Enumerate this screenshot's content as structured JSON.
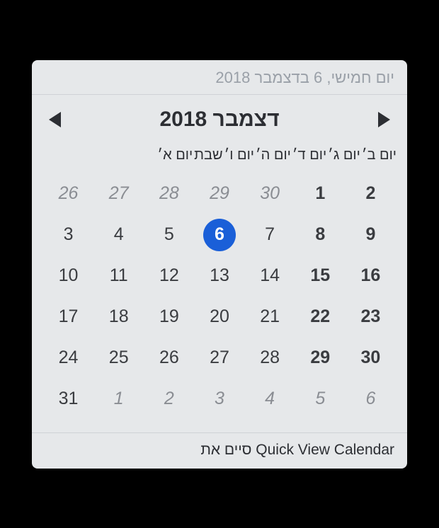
{
  "header_date": "יום חמישי, 6 בדצמבר 2018",
  "month_title": "דצמבר 2018",
  "weekdays": [
    "יום א׳",
    "שבת",
    "יום ו׳",
    "יום ה׳",
    "יום ד׳",
    "יום ג׳",
    "יום ב׳"
  ],
  "footer": "סיים את Quick View Calendar",
  "days": [
    {
      "n": "26",
      "other": true
    },
    {
      "n": "27",
      "other": true
    },
    {
      "n": "28",
      "other": true
    },
    {
      "n": "29",
      "other": true
    },
    {
      "n": "30",
      "other": true
    },
    {
      "n": "1",
      "bold": true
    },
    {
      "n": "2",
      "bold": true
    },
    {
      "n": "3"
    },
    {
      "n": "4"
    },
    {
      "n": "5"
    },
    {
      "n": "6",
      "selected": true
    },
    {
      "n": "7"
    },
    {
      "n": "8",
      "bold": true
    },
    {
      "n": "9",
      "bold": true
    },
    {
      "n": "10"
    },
    {
      "n": "11"
    },
    {
      "n": "12"
    },
    {
      "n": "13"
    },
    {
      "n": "14"
    },
    {
      "n": "15",
      "bold": true
    },
    {
      "n": "16",
      "bold": true
    },
    {
      "n": "17"
    },
    {
      "n": "18"
    },
    {
      "n": "19"
    },
    {
      "n": "20"
    },
    {
      "n": "21"
    },
    {
      "n": "22",
      "bold": true
    },
    {
      "n": "23",
      "bold": true
    },
    {
      "n": "24"
    },
    {
      "n": "25"
    },
    {
      "n": "26"
    },
    {
      "n": "27"
    },
    {
      "n": "28"
    },
    {
      "n": "29",
      "bold": true
    },
    {
      "n": "30",
      "bold": true
    },
    {
      "n": "31"
    },
    {
      "n": "1",
      "other": true
    },
    {
      "n": "2",
      "other": true
    },
    {
      "n": "3",
      "other": true
    },
    {
      "n": "4",
      "other": true
    },
    {
      "n": "5",
      "other": true
    },
    {
      "n": "6",
      "other": true
    }
  ]
}
